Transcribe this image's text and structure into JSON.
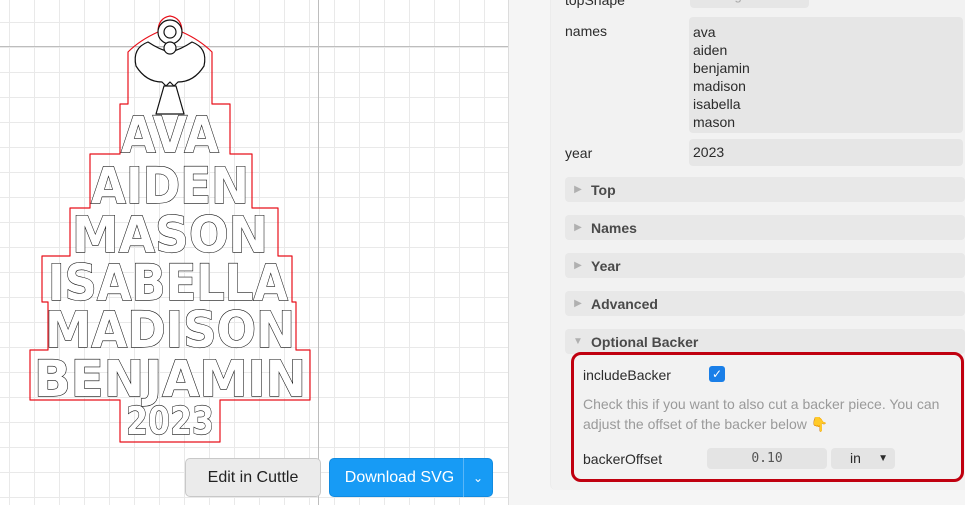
{
  "canvas": {
    "ornament": {
      "names": [
        "AVA",
        "AIDEN",
        "MASON",
        "ISABELLA",
        "MADISON",
        "BENJAMIN"
      ],
      "year": "2023",
      "top_shape_icon": "angel-icon"
    }
  },
  "buttons": {
    "edit": "Edit in Cuttle",
    "download": "Download SVG",
    "download_caret": "⌄"
  },
  "panel": {
    "top_shape": {
      "label": "topShape",
      "value": "angel"
    },
    "names": {
      "label": "names",
      "lines": [
        "ava",
        "aiden",
        "benjamin",
        "madison",
        "isabella",
        "mason"
      ]
    },
    "year": {
      "label": "year",
      "value": "2023"
    },
    "sections": [
      "Top",
      "Names",
      "Year",
      "Advanced",
      "Optional Backer"
    ],
    "backer": {
      "include_label": "includeBacker",
      "include_checked": true,
      "help": "Check this if you want to also cut a backer piece. You can adjust the offset of the backer below 👇",
      "offset_label": "backerOffset",
      "offset_value": "0.10",
      "unit": "in"
    }
  },
  "colors": {
    "accent": "#179bf5",
    "highlight": "#c0000f",
    "cut_outline": "#e8101a"
  }
}
